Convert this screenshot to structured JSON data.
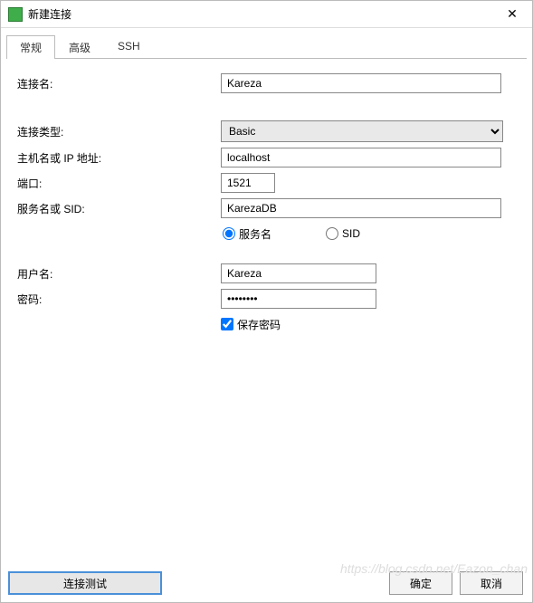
{
  "window": {
    "title": "新建连接"
  },
  "tabs": {
    "general": "常规",
    "advanced": "高级",
    "ssh": "SSH"
  },
  "labels": {
    "conn_name": "连接名:",
    "conn_type": "连接类型:",
    "host": "主机名或 IP 地址:",
    "port": "端口:",
    "service_sid": "服务名或 SID:",
    "service": "服务名",
    "sid": "SID",
    "user": "用户名:",
    "password": "密码:",
    "save_pw": "保存密码"
  },
  "values": {
    "conn_name": "Kareza",
    "conn_type": "Basic",
    "host": "localhost",
    "port": "1521",
    "service_sid": "KarezaDB",
    "user": "Kareza",
    "password": "••••••••",
    "radio_selected": "service",
    "save_pw_checked": true
  },
  "buttons": {
    "test": "连接测试",
    "ok": "确定",
    "cancel": "取消"
  },
  "watermark": "https://blog.csdn.net/Eazon_chan"
}
